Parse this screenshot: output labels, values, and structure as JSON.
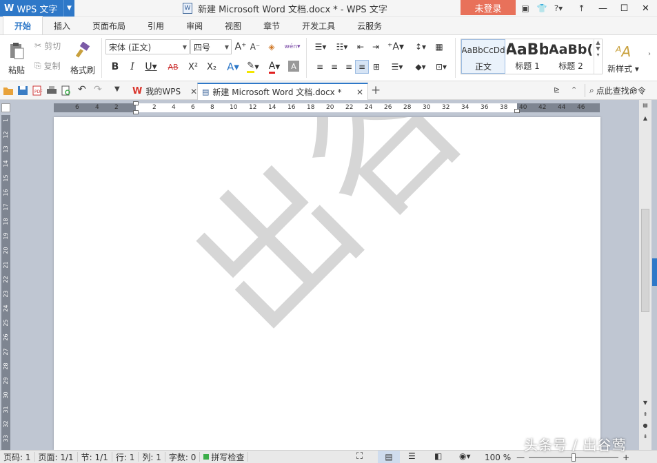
{
  "titlebar": {
    "app_name": "WPS 文字",
    "document_title": "新建 Microsoft Word 文档.docx * - WPS 文字",
    "login_label": "未登录"
  },
  "menu_tabs": [
    "开始",
    "插入",
    "页面布局",
    "引用",
    "审阅",
    "视图",
    "章节",
    "开发工具",
    "云服务"
  ],
  "ribbon": {
    "paste_label": "粘贴",
    "cut_label": "剪切",
    "copy_label": "复制",
    "format_painter_label": "格式刷",
    "font_name": "宋体 (正文)",
    "font_size": "四号",
    "bold": "B",
    "italic": "I",
    "underline": "U",
    "strikethrough": "AB",
    "superscript": "X²",
    "subscript": "X₂",
    "styles": [
      {
        "sample": "AaBbCcDd",
        "label": "正文"
      },
      {
        "sample": "AaBb",
        "label": "标题 1"
      },
      {
        "sample": "AaBb(",
        "label": "标题 2"
      }
    ],
    "new_style_label": "新样式"
  },
  "quick_bar": {
    "my_wps_tab": "我的WPS",
    "doc_tab": "新建 Microsoft Word 文档.docx *",
    "search_label": "点此查找命令"
  },
  "ruler": {
    "h_left": [
      "6",
      "4",
      "2"
    ],
    "h_right": [
      "2",
      "4",
      "6",
      "8",
      "10",
      "12",
      "14",
      "16",
      "18",
      "20",
      "22",
      "24",
      "26",
      "28",
      "30",
      "32",
      "34",
      "36",
      "38",
      "40",
      "42",
      "44",
      "46"
    ],
    "v_numbers": [
      "1",
      "12",
      "13",
      "14",
      "15",
      "16",
      "17",
      "18",
      "19",
      "20",
      "21",
      "22",
      "23",
      "24",
      "25",
      "26",
      "27",
      "28",
      "29",
      "30",
      "31",
      "32",
      "33"
    ]
  },
  "watermark_text": "出谷莺",
  "status": {
    "page_code": "页码: 1",
    "page": "页面: 1/1",
    "section": "节: 1/1",
    "line": "行: 1",
    "column": "列: 1",
    "word_count": "字数: 0",
    "spell_check": "拼写检查",
    "zoom": "100 %"
  },
  "brand_watermark": "头条号 / 出谷莺",
  "colors": {
    "accent": "#2e78c8",
    "login": "#e8715a",
    "workspace": "#bfc6d2"
  }
}
